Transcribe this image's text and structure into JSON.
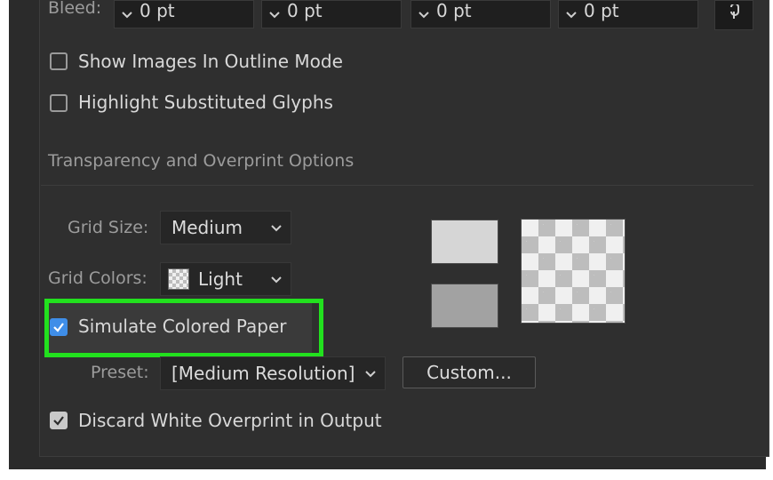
{
  "bleed": {
    "label": "Bleed:",
    "fields": [
      {
        "value": "0 pt"
      },
      {
        "value": "0 pt"
      },
      {
        "value": "0 pt"
      },
      {
        "value": "0 pt"
      }
    ],
    "link_icon": "chain-link-icon"
  },
  "options": {
    "show_images_outline": {
      "label": "Show Images In Outline Mode",
      "checked": false
    },
    "highlight_glyphs": {
      "label": "Highlight Substituted Glyphs",
      "checked": false
    }
  },
  "transparency": {
    "section_title": "Transparency and Overprint Options",
    "grid_size": {
      "label": "Grid Size:",
      "value": "Medium"
    },
    "grid_colors": {
      "label": "Grid Colors:",
      "value": "Light",
      "swatch_icon": "checkerboard-icon"
    },
    "simulate_paper": {
      "label": "Simulate Colored Paper",
      "checked": true
    },
    "preset": {
      "label": "Preset:",
      "value": "[Medium Resolution]"
    },
    "custom_button": "Custom...",
    "discard_white": {
      "label": "Discard White Overprint in Output",
      "checked": true
    },
    "colors": {
      "swatch_light": "#d6d6d6",
      "swatch_dark": "#a2a2a2",
      "highlight": "#22e11e",
      "check_accent": "#3f8ee8"
    }
  }
}
